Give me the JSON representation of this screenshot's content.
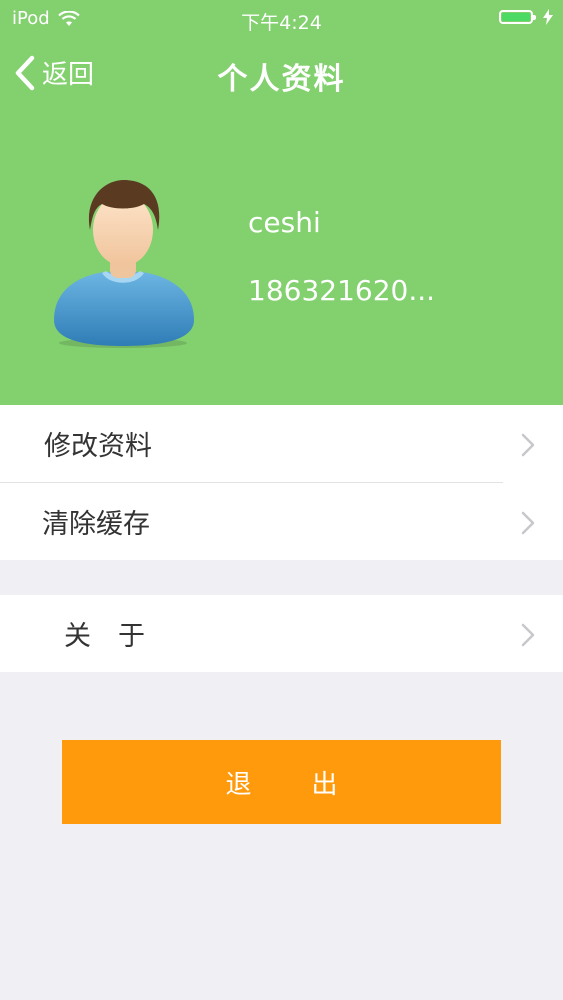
{
  "status_bar": {
    "carrier": "iPod",
    "time": "下午4:24",
    "wifi_icon": "wifi-icon",
    "battery_icon": "battery-icon",
    "battery_level": 1.0,
    "charging_icon": "bolt-icon"
  },
  "nav": {
    "back_label": "返回",
    "back_icon": "chevron-left-icon",
    "title": "个人资料"
  },
  "profile": {
    "avatar_icon": "user-avatar-icon",
    "name": "ceshi",
    "phone": "186321620..."
  },
  "menu": {
    "items": [
      {
        "label": "修改资料",
        "icon": "chevron-right-icon"
      },
      {
        "label": "清除缓存",
        "icon": "chevron-right-icon"
      }
    ],
    "about": {
      "label": "关　于",
      "icon": "chevron-right-icon"
    }
  },
  "logout": {
    "label": "退出"
  },
  "colors": {
    "header_bg": "#82d06e",
    "page_bg": "#efeff4",
    "logout_bg": "#ff9a0d",
    "chevron": "#c7c7cc"
  }
}
